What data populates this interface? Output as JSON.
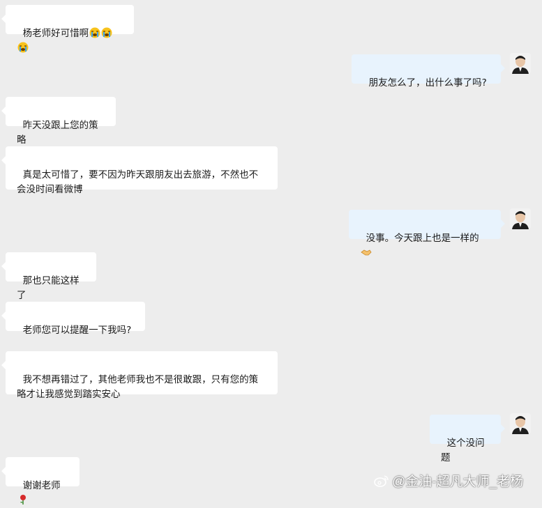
{
  "conversation": {
    "messages": [
      {
        "side": "left",
        "text": "杨老师好可惜啊",
        "emoji": "crying-face-icon x3"
      },
      {
        "side": "right",
        "text": "朋友怎么了，出什么事了吗?"
      },
      {
        "side": "left",
        "text": "昨天没跟上您的策略"
      },
      {
        "side": "left",
        "text": "真是太可惜了，要不因为昨天跟朋友出去旅游，不然也不\n会没时间看微博"
      },
      {
        "side": "right",
        "text": "没事。今天跟上也是一样的",
        "emoji": "handshake-icon"
      },
      {
        "side": "left",
        "text": "那也只能这样了"
      },
      {
        "side": "left",
        "text": "老师您可以提醒一下我吗?"
      },
      {
        "side": "left",
        "text": "我不想再错过了，其他老师我也不是很敢跟，只有您的策\n略才让我感觉到踏实安心"
      },
      {
        "side": "right",
        "text": "这个没问题"
      },
      {
        "side": "left",
        "text": "谢谢老师",
        "emoji": "rose-icon"
      }
    ]
  },
  "watermark": {
    "text": "@金油-超凡大师_老杨"
  },
  "colors": {
    "background": "#ededed",
    "left_bubble": "#ffffff",
    "right_bubble": "#e8f3fd"
  }
}
